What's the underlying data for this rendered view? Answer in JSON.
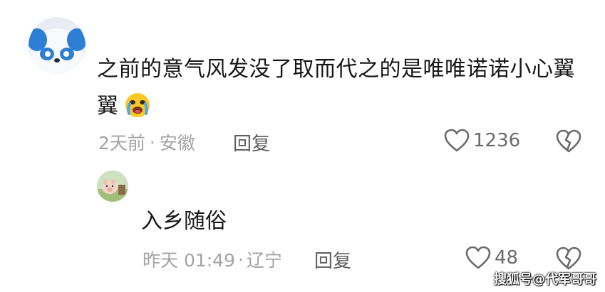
{
  "comment": {
    "text": "之前的意气风发没了取而代之的是唯唯诺诺小心翼翼",
    "time": "2天前",
    "separator": "·",
    "location": "安徽",
    "reply_label": "回复",
    "like_count": "1236",
    "emoji": "crying-face-icon"
  },
  "reply": {
    "text": "入乡随俗",
    "time": "昨天 01:49",
    "separator": "·",
    "location": "辽宁",
    "reply_label": "回复",
    "like_count": "48"
  },
  "watermark": "搜狐号@代军哥哥",
  "colors": {
    "text": "#161616",
    "meta": "#a3a3a3",
    "action": "#5e5e5e",
    "background": "#ffffff"
  }
}
